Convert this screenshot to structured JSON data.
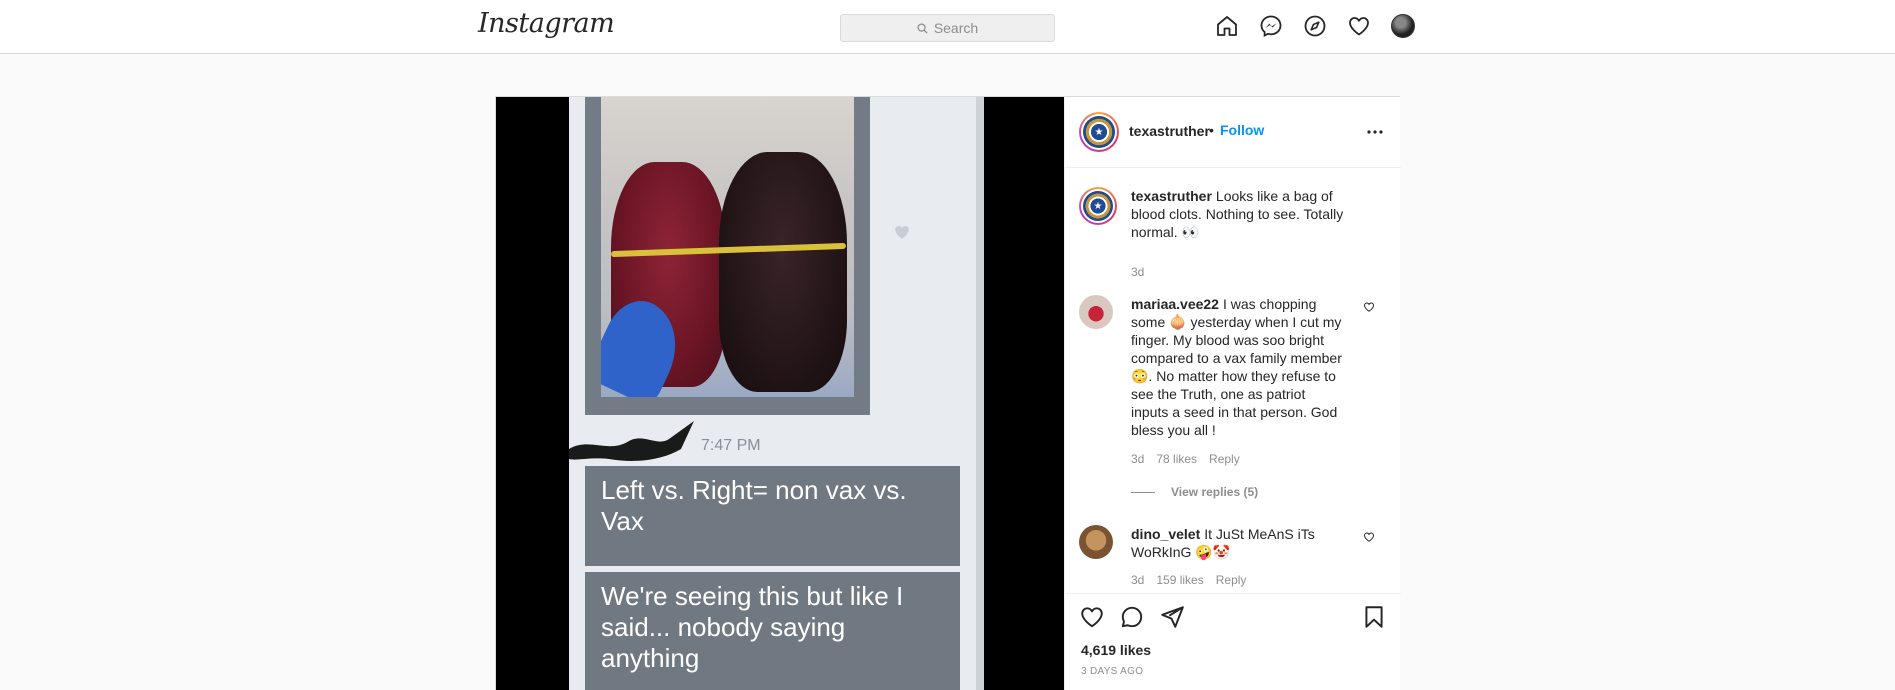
{
  "nav": {
    "logo_text": "Instagram",
    "search_placeholder": "Search",
    "icons": [
      "home-icon",
      "messenger-icon",
      "explore-icon",
      "activity-heart-icon",
      "profile-avatar"
    ]
  },
  "post": {
    "media": {
      "timestamp": "7:47 PM",
      "message_1": "Left vs. Right= non vax vs. Vax",
      "message_2": "We're seeing this but like I said... nobody saying anything"
    },
    "header": {
      "username": "texastruther",
      "separator": "•",
      "follow_label": "Follow"
    },
    "caption": {
      "username": "texastruther",
      "text": "Looks like a bag of blood clots. Nothing to see. Totally normal. 👀",
      "age": "3d"
    },
    "comments": [
      {
        "username": "mariaa.vee22",
        "text": "I was chopping some 🧅 yesterday when I cut my finger. My blood was soo bright compared to a vax family member 😳. No matter how they refuse to see the Truth, one as patriot inputs a seed in that person. God bless you all !",
        "age": "3d",
        "likes": "78 likes",
        "reply_label": "Reply",
        "view_replies": "View replies (5)"
      },
      {
        "username": "dino_velet",
        "text": "It JuSt MeAnS iTs WoRkInG 🤪🤡",
        "age": "3d",
        "likes": "159 likes",
        "reply_label": "Reply"
      }
    ],
    "likes_count": "4,619 likes",
    "posted_ago": "3 DAYS AGO"
  },
  "colors": {
    "accent": "#0095f6",
    "border": "#dbdbdb",
    "bubble": "#707882"
  }
}
